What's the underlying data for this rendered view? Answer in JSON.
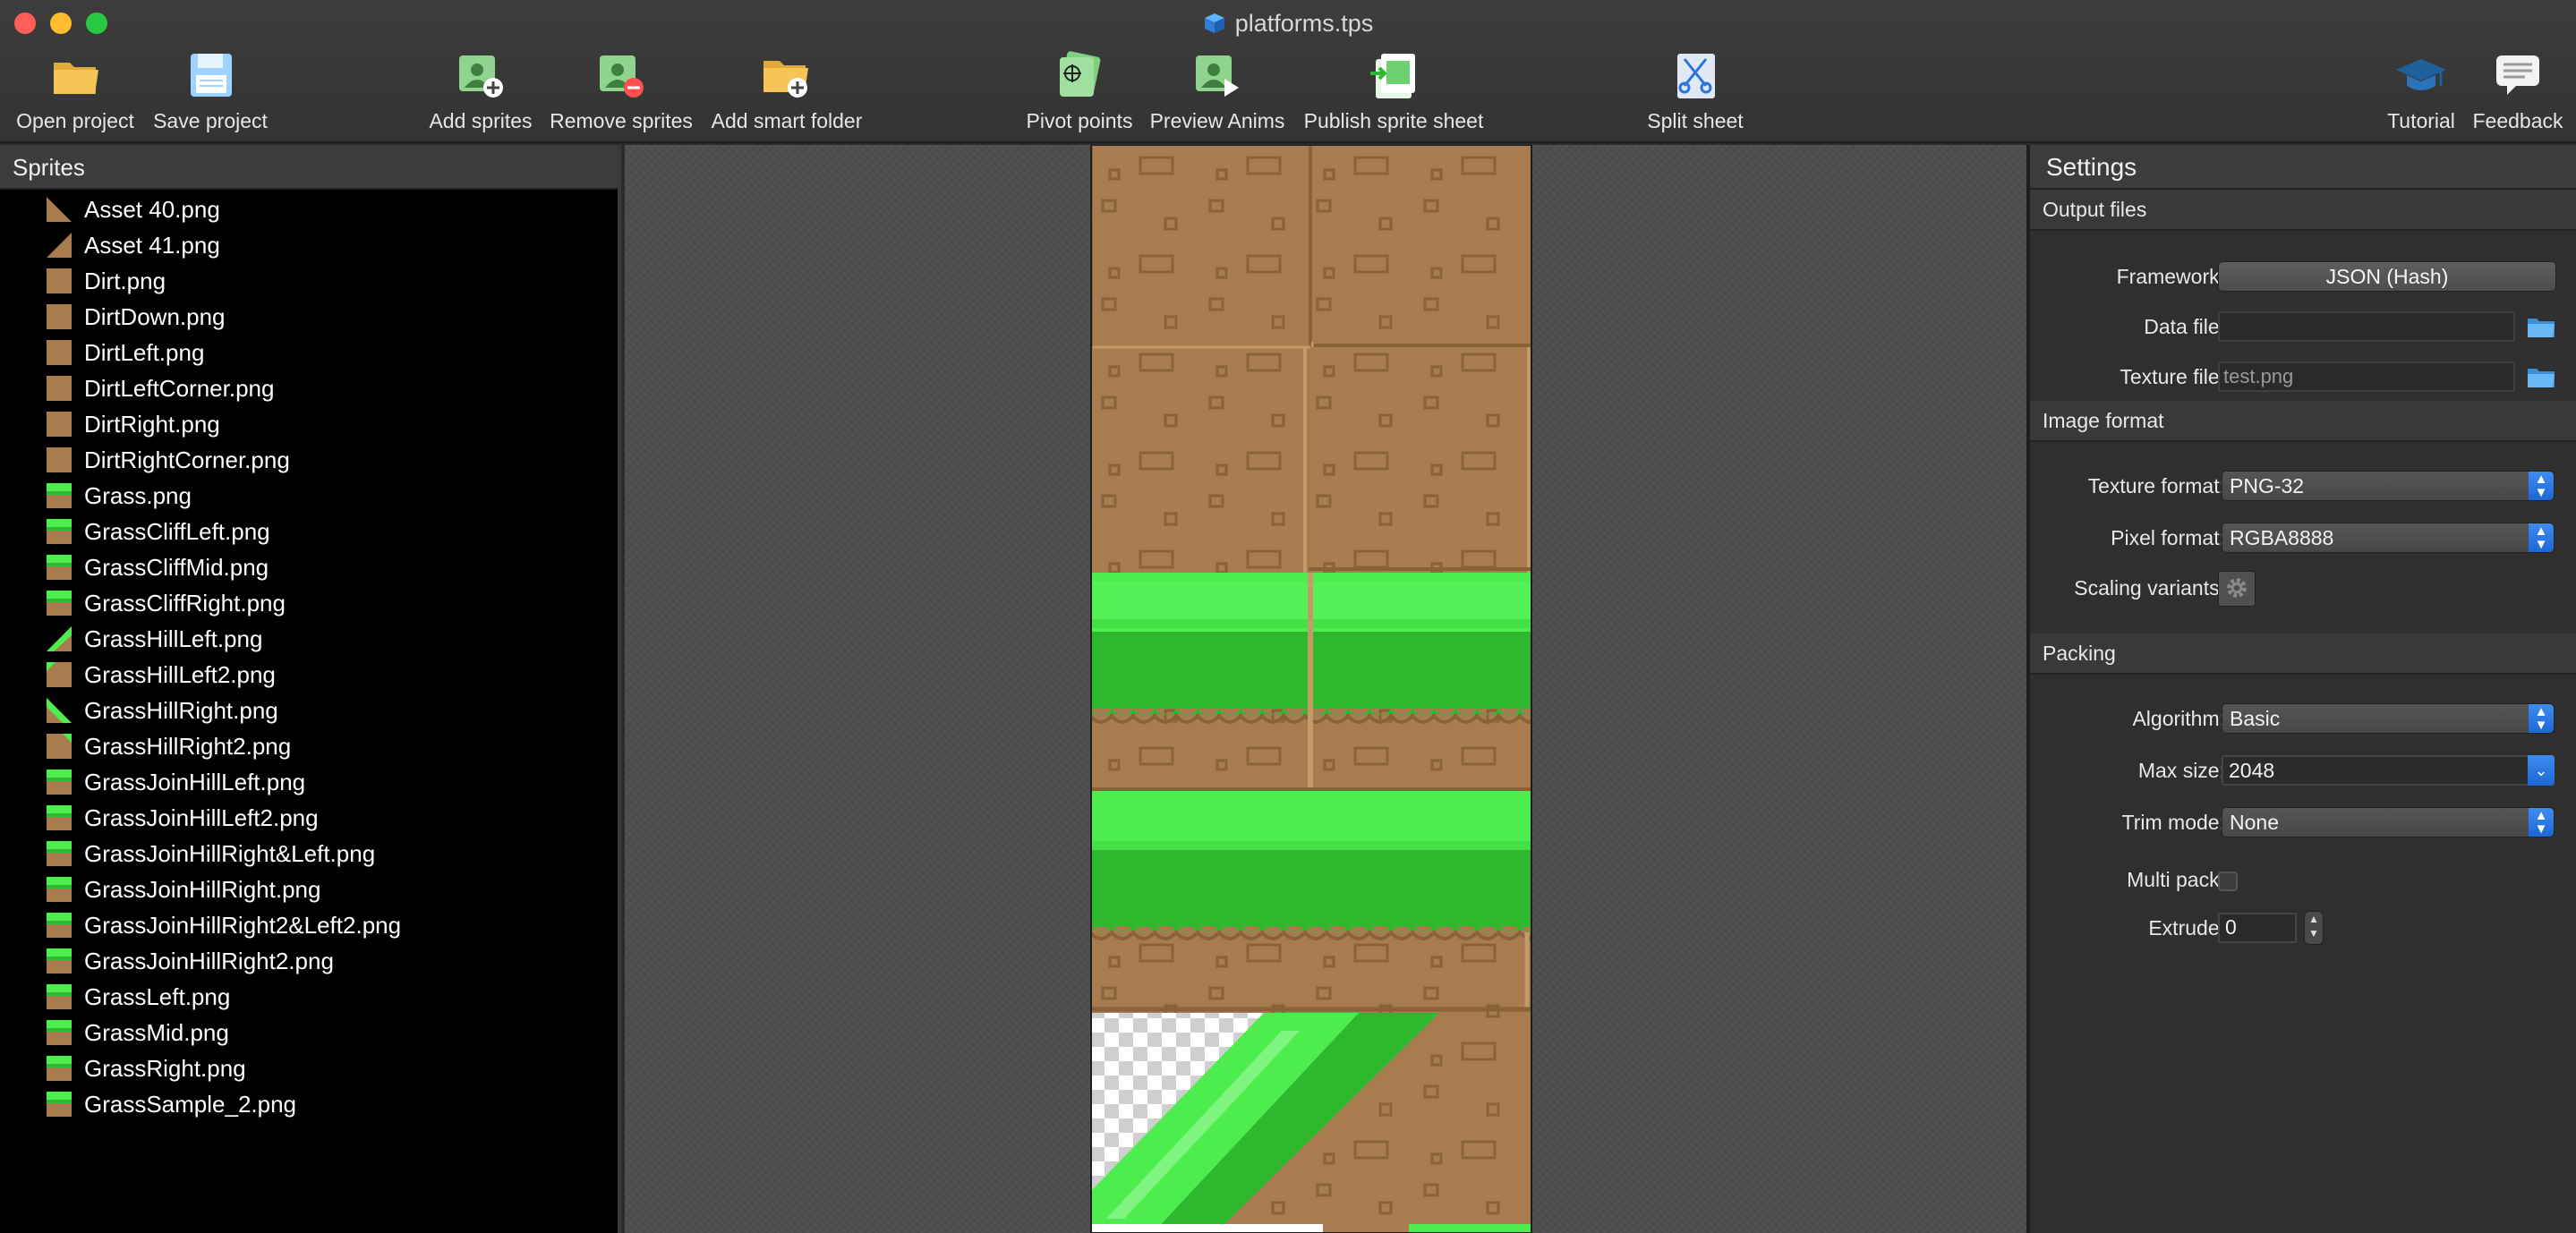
{
  "window": {
    "title": "platforms.tps"
  },
  "toolbar": {
    "open_project": "Open project",
    "save_project": "Save project",
    "add_sprites": "Add sprites",
    "remove_sprites": "Remove sprites",
    "add_smart_folder": "Add smart folder",
    "pivot_points": "Pivot points",
    "preview_anims": "Preview Anims",
    "publish_sprite_sheet": "Publish sprite sheet",
    "split_sheet": "Split sheet",
    "tutorial": "Tutorial",
    "feedback": "Feedback"
  },
  "sprites_panel": {
    "title": "Sprites",
    "items": [
      {
        "name": "Asset 40.png",
        "thumb": "ramp-right"
      },
      {
        "name": "Asset 41.png",
        "thumb": "ramp-left"
      },
      {
        "name": "Dirt.png",
        "thumb": "dirt"
      },
      {
        "name": "DirtDown.png",
        "thumb": "dirt"
      },
      {
        "name": "DirtLeft.png",
        "thumb": "dirt"
      },
      {
        "name": "DirtLeftCorner.png",
        "thumb": "dirt"
      },
      {
        "name": "DirtRight.png",
        "thumb": "dirt"
      },
      {
        "name": "DirtRightCorner.png",
        "thumb": "dirt"
      },
      {
        "name": "Grass.png",
        "thumb": "grass"
      },
      {
        "name": "GrassCliffLeft.png",
        "thumb": "grass"
      },
      {
        "name": "GrassCliffMid.png",
        "thumb": "grass"
      },
      {
        "name": "GrassCliffRight.png",
        "thumb": "grass"
      },
      {
        "name": "GrassHillLeft.png",
        "thumb": "hill-left"
      },
      {
        "name": "GrassHillLeft2.png",
        "thumb": "hill-left2"
      },
      {
        "name": "GrassHillRight.png",
        "thumb": "hill-right"
      },
      {
        "name": "GrassHillRight2.png",
        "thumb": "hill-right2"
      },
      {
        "name": "GrassJoinHillLeft.png",
        "thumb": "grass"
      },
      {
        "name": "GrassJoinHillLeft2.png",
        "thumb": "grass"
      },
      {
        "name": "GrassJoinHillRight&Left.png",
        "thumb": "grass"
      },
      {
        "name": "GrassJoinHillRight.png",
        "thumb": "grass"
      },
      {
        "name": "GrassJoinHillRight2&Left2.png",
        "thumb": "grass"
      },
      {
        "name": "GrassJoinHillRight2.png",
        "thumb": "grass"
      },
      {
        "name": "GrassLeft.png",
        "thumb": "grass"
      },
      {
        "name": "GrassMid.png",
        "thumb": "grass"
      },
      {
        "name": "GrassRight.png",
        "thumb": "grass"
      },
      {
        "name": "GrassSample_2.png",
        "thumb": "grass"
      }
    ]
  },
  "settings": {
    "title": "Settings",
    "output_files": {
      "header": "Output files",
      "framework_label": "Framework:",
      "framework_value": "JSON (Hash)",
      "data_file_label": "Data file:",
      "data_file_value": "",
      "texture_file_label": "Texture file:",
      "texture_file_placeholder": "test.png"
    },
    "image_format": {
      "header": "Image format",
      "texture_format_label": "Texture format:",
      "texture_format_value": "PNG-32",
      "pixel_format_label": "Pixel format:",
      "pixel_format_value": "RGBA8888",
      "scaling_variants_label": "Scaling variants:"
    },
    "packing": {
      "header": "Packing",
      "algorithm_label": "Algorithm:",
      "algorithm_value": "Basic",
      "max_size_label": "Max size:",
      "max_size_value": "2048",
      "trim_mode_label": "Trim mode:",
      "trim_mode_value": "None",
      "multi_pack_label": "Multi pack:",
      "multi_pack_checked": false,
      "extrude_label": "Extrude:",
      "extrude_value": "0"
    }
  },
  "colors": {
    "dirt": "#a97c50",
    "dirt_dark": "#8a6238",
    "grass_light": "#4ded4d",
    "grass_dark": "#2eb82e",
    "accent": "#2a73e0"
  }
}
